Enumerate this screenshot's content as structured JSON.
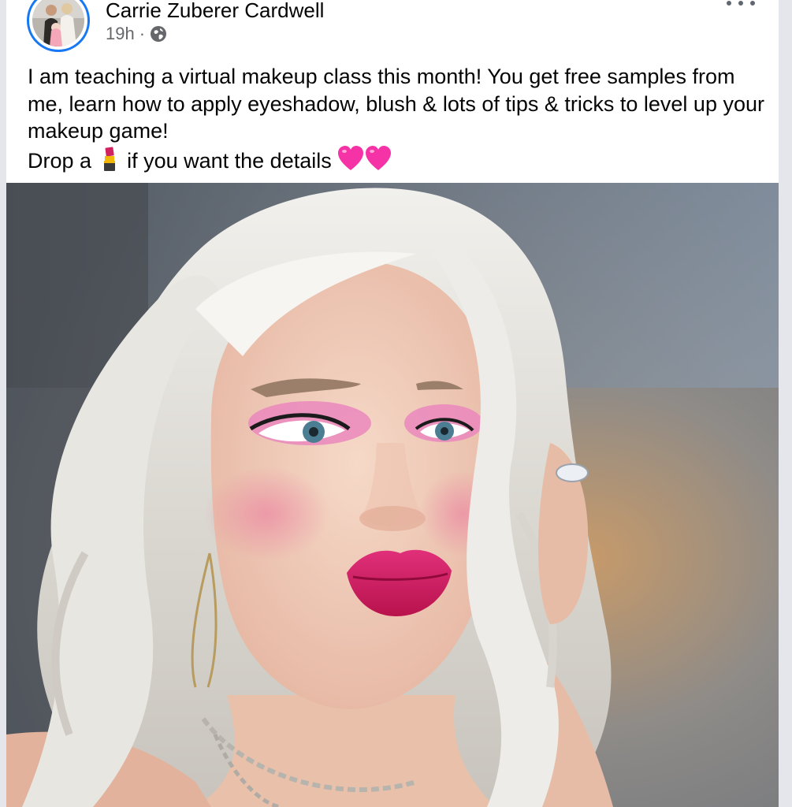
{
  "post": {
    "author": "Carrie Zuberer Cardwell",
    "timestamp": "19h",
    "separator": "·",
    "privacy_icon": "globe-icon",
    "more_icon": "more-options-icon",
    "text": {
      "line1": "I am teaching a virtual makeup class this month! You get free samples from me, learn how to apply eyeshadow, blush & lots of tips & tricks to level up your makeup game!",
      "line2_before": "Drop a",
      "line2_emoji_1": "lipstick-emoji",
      "line2_after": "if you want the details",
      "line2_emoji_2": "pink-heart-emoji"
    },
    "photo": "photo of a blonde woman with pink eyeshadow and magenta lipstick making a kissing face"
  },
  "colors": {
    "avatar_ring": "#1877f2",
    "name": "#050505",
    "meta": "#65676b",
    "lipstick": "#d0225f",
    "heart": "#f533a6"
  }
}
